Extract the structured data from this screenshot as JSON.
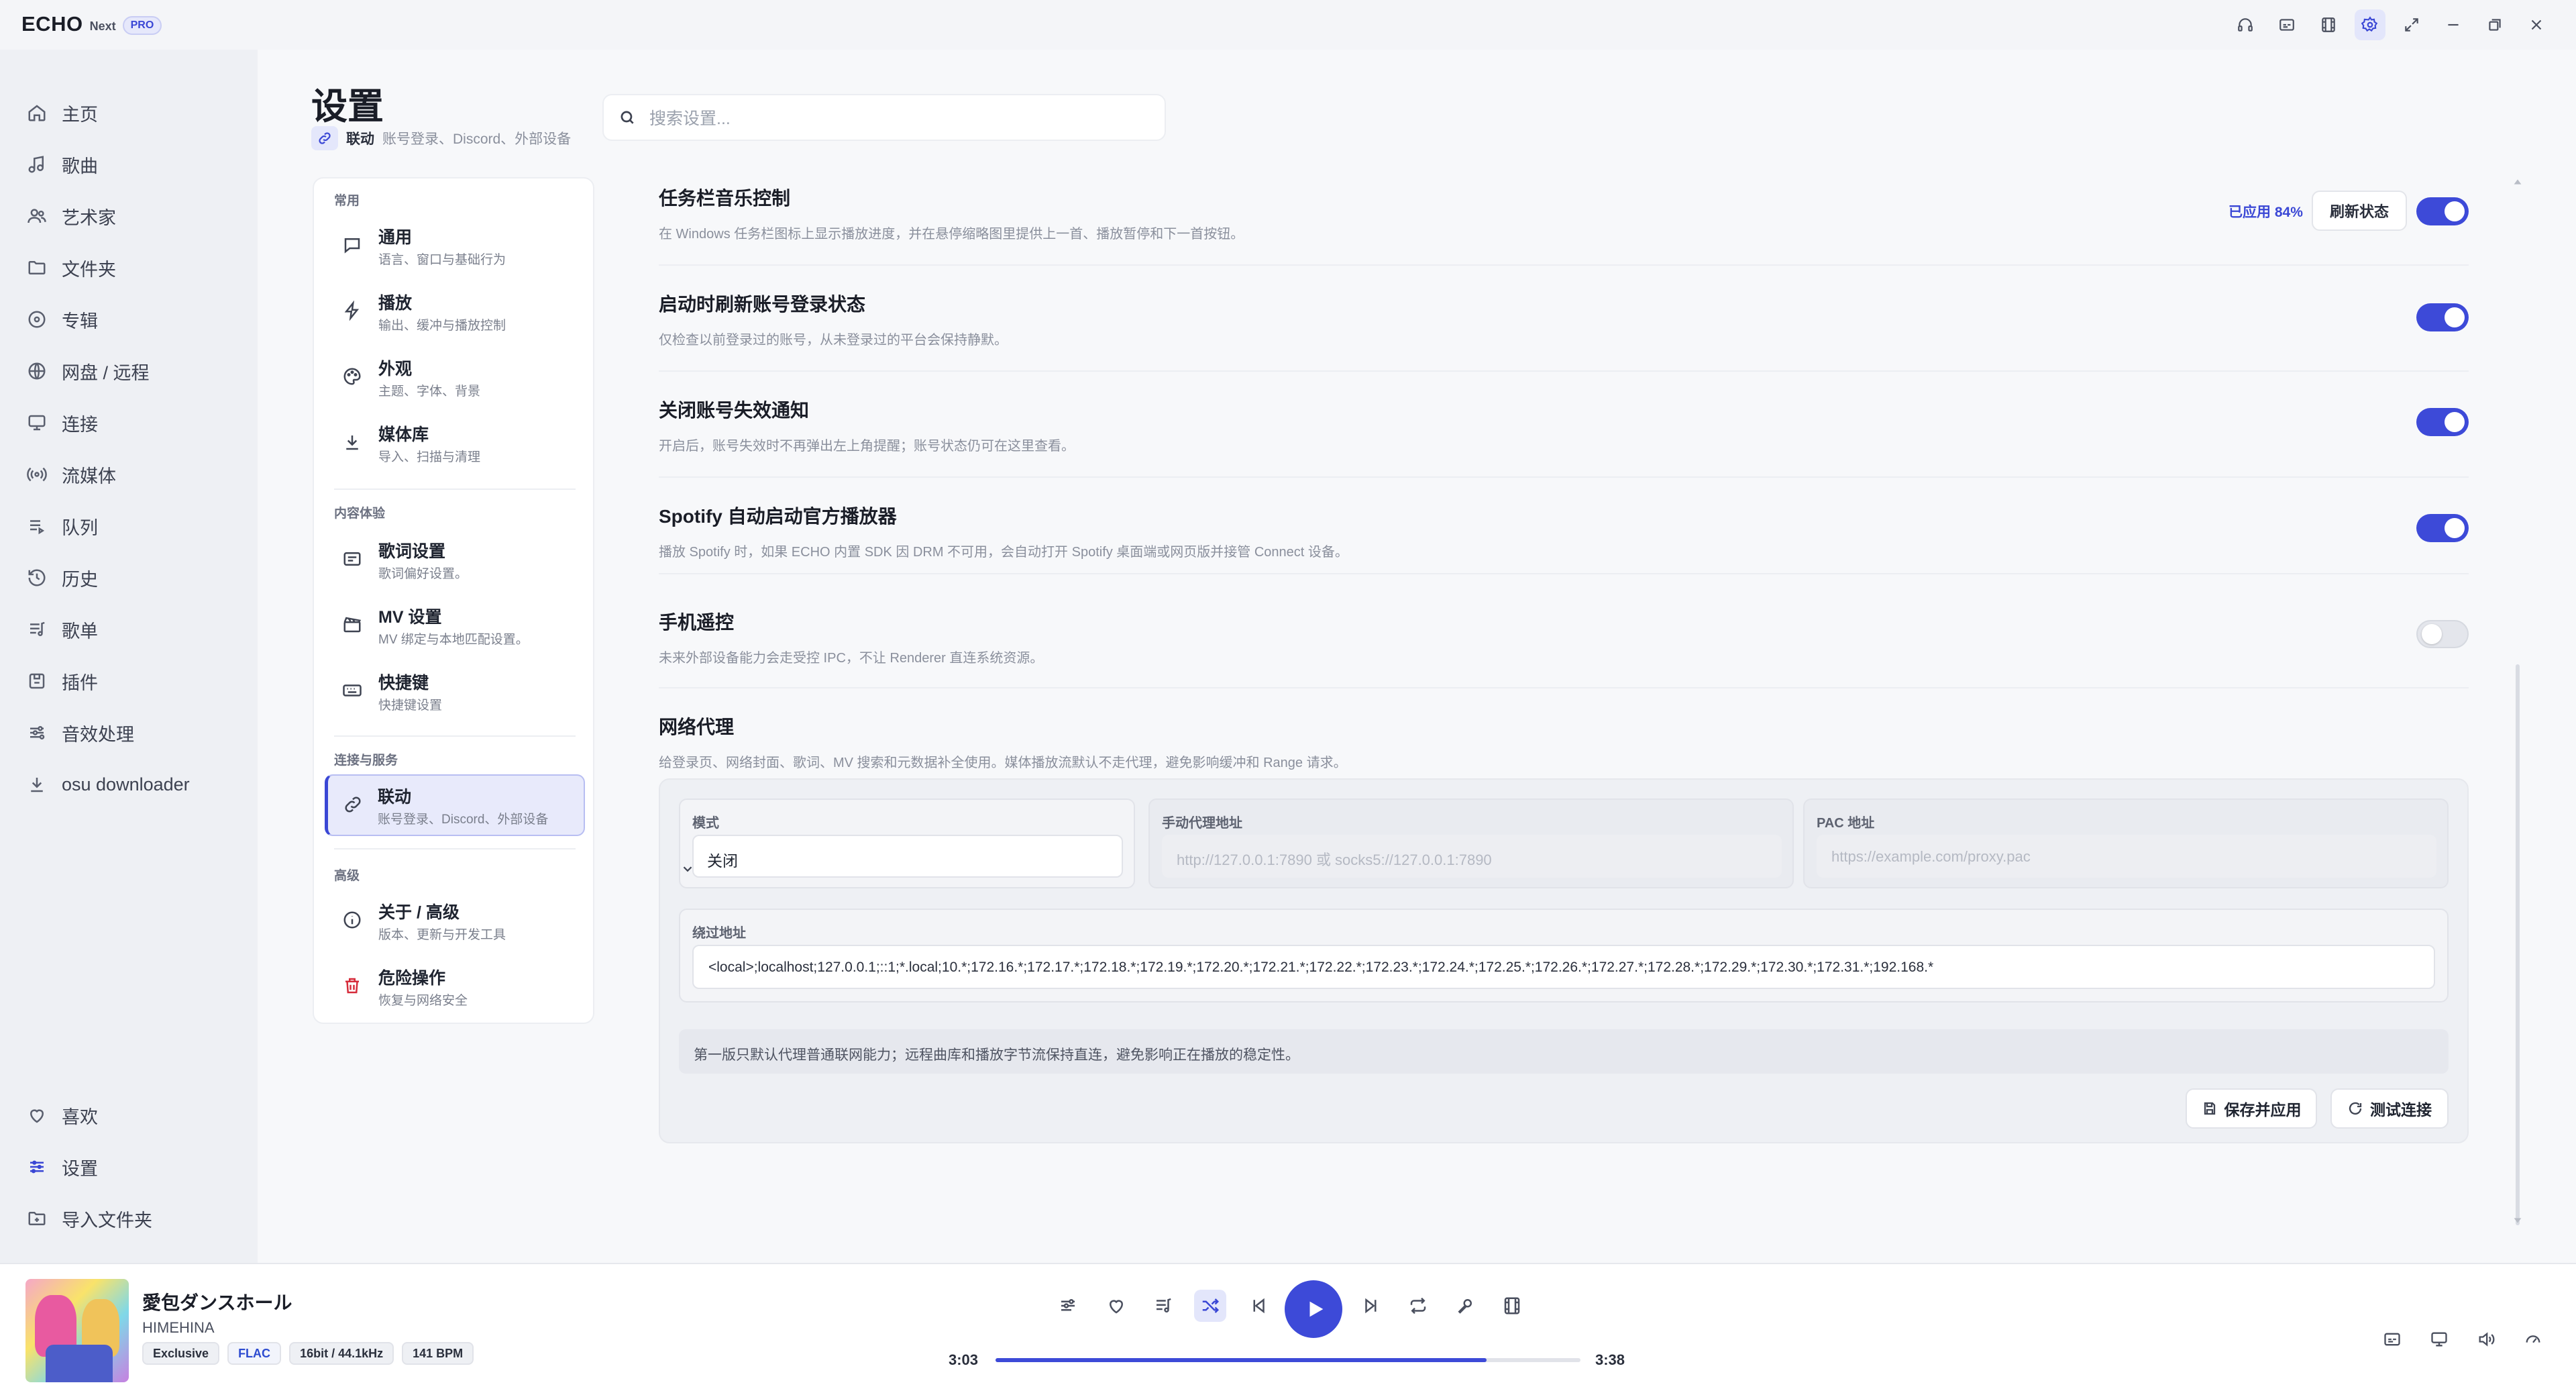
{
  "app": {
    "logo": "ECHO",
    "logo_sub": "Next",
    "logo_badge": "PRO",
    "window_icons": [
      "headphones-icon",
      "subtitles-icon",
      "film-icon",
      "settings-icon",
      "expand-icon",
      "minimize-icon",
      "restore-icon",
      "close-icon"
    ]
  },
  "sidebar": {
    "items": [
      {
        "label": "主页",
        "icon": "home-icon"
      },
      {
        "label": "歌曲",
        "icon": "music-note-icon"
      },
      {
        "label": "艺术家",
        "icon": "users-icon"
      },
      {
        "label": "文件夹",
        "icon": "folder-icon"
      },
      {
        "label": "专辑",
        "icon": "disc-icon"
      },
      {
        "label": "网盘 / 远程",
        "icon": "globe-icon"
      },
      {
        "label": "连接",
        "icon": "cast-icon"
      },
      {
        "label": "流媒体",
        "icon": "broadcast-icon"
      },
      {
        "label": "队列",
        "icon": "queue-icon"
      },
      {
        "label": "历史",
        "icon": "history-icon"
      },
      {
        "label": "歌单",
        "icon": "playlist-icon"
      },
      {
        "label": "插件",
        "icon": "plugin-icon"
      },
      {
        "label": "音效处理",
        "icon": "equalizer-icon"
      },
      {
        "label": "osu downloader",
        "icon": "download-icon"
      }
    ],
    "bottom_items": [
      {
        "label": "喜欢",
        "icon": "heart-icon"
      },
      {
        "label": "设置",
        "icon": "sliders-icon"
      },
      {
        "label": "导入文件夹",
        "icon": "folder-plus-icon"
      }
    ]
  },
  "header": {
    "title": "设置",
    "current_section": "联动",
    "current_desc": "账号登录、Discord、外部设备",
    "search_placeholder": "搜索设置..."
  },
  "settings_nav": {
    "groups": [
      {
        "label": "常用",
        "items": [
          {
            "title": "通用",
            "desc": "语言、窗口与基础行为",
            "icon": "message-icon"
          },
          {
            "title": "播放",
            "desc": "输出、缓冲与播放控制",
            "icon": "bolt-icon"
          },
          {
            "title": "外观",
            "desc": "主题、字体、背景",
            "icon": "palette-icon"
          },
          {
            "title": "媒体库",
            "desc": "导入、扫描与清理",
            "icon": "download-icon"
          }
        ]
      },
      {
        "label": "内容体验",
        "items": [
          {
            "title": "歌词设置",
            "desc": "歌词偏好设置。",
            "icon": "lyrics-icon"
          },
          {
            "title": "MV 设置",
            "desc": "MV 绑定与本地匹配设置。",
            "icon": "clapperboard-icon"
          },
          {
            "title": "快捷键",
            "desc": "快捷键设置",
            "icon": "keyboard-icon"
          }
        ]
      },
      {
        "label": "连接与服务",
        "items": [
          {
            "title": "联动",
            "desc": "账号登录、Discord、外部设备",
            "icon": "link-icon",
            "active": true
          }
        ]
      },
      {
        "label": "高级",
        "items": [
          {
            "title": "关于 / 高级",
            "desc": "版本、更新与开发工具",
            "icon": "info-icon"
          },
          {
            "title": "危险操作",
            "desc": "恢复与网络安全",
            "icon": "trash-icon"
          }
        ]
      }
    ]
  },
  "rows": [
    {
      "title": "任务栏音乐控制",
      "desc": "在 Windows 任务栏图标上显示播放进度，并在悬停缩略图里提供上一首、播放暂停和下一首按钮。",
      "enabled": true,
      "applied_label": "已应用 84%",
      "action_label": "刷新状态"
    },
    {
      "title": "启动时刷新账号登录状态",
      "desc": "仅检查以前登录过的账号，从未登录过的平台会保持静默。",
      "enabled": true
    },
    {
      "title": "关闭账号失效通知",
      "desc": "开启后，账号失效时不再弹出左上角提醒；账号状态仍可在这里查看。",
      "enabled": true
    },
    {
      "title": "Spotify 自动启动官方播放器",
      "desc": "播放 Spotify 时，如果 ECHO 内置 SDK 因 DRM 不可用，会自动打开 Spotify 桌面端或网页版并接管 Connect 设备。",
      "enabled": true
    },
    {
      "title": "手机遥控",
      "desc": "未来外部设备能力会走受控 IPC，不让 Renderer 直连系统资源。",
      "enabled": false
    }
  ],
  "proxy": {
    "title": "网络代理",
    "desc": "给登录页、网络封面、歌词、MV 搜索和元数据补全使用。媒体播放流默认不走代理，避免影响缓冲和 Range 请求。",
    "mode_label": "模式",
    "mode_value": "关闭",
    "manual_label": "手动代理地址",
    "manual_placeholder": "http://127.0.0.1:7890 或 socks5://127.0.0.1:7890",
    "pac_label": "PAC 地址",
    "pac_placeholder": "https://example.com/proxy.pac",
    "bypass_label": "绕过地址",
    "bypass_value": "<local>;localhost;127.0.0.1;::1;*.local;10.*;172.16.*;172.17.*;172.18.*;172.19.*;172.20.*;172.21.*;172.22.*;172.23.*;172.24.*;172.25.*;172.26.*;172.27.*;172.28.*;172.29.*;172.30.*;172.31.*;192.168.*",
    "note": "第一版只默认代理普通联网能力；远程曲库和播放字节流保持直连，避免影响正在播放的稳定性。",
    "save_label": "保存并应用",
    "test_label": "测试连接"
  },
  "player": {
    "title": "愛包ダンスホール",
    "artist": "HIMEHINA",
    "badges": [
      "Exclusive",
      "FLAC",
      "16bit / 44.1kHz",
      "141 BPM"
    ],
    "current_time": "3:03",
    "total_time": "3:38",
    "progress": 0.84,
    "accent": "#3d4ad8"
  }
}
